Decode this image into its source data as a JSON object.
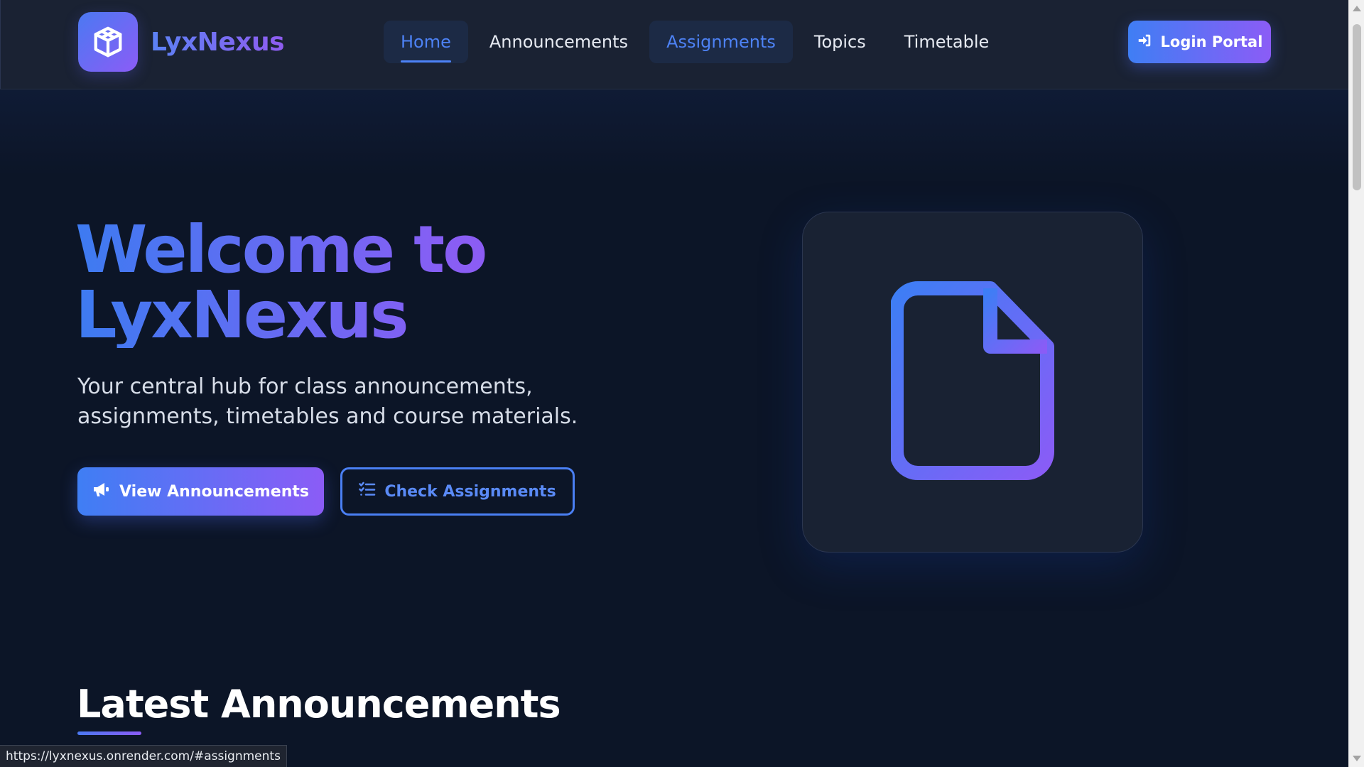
{
  "brand": {
    "name": "LyxNexus",
    "logo_icon": "cube-icon"
  },
  "nav": {
    "items": [
      {
        "label": "Home",
        "state": "active"
      },
      {
        "label": "Announcements",
        "state": "normal"
      },
      {
        "label": "Assignments",
        "state": "hover"
      },
      {
        "label": "Topics",
        "state": "normal"
      },
      {
        "label": "Timetable",
        "state": "normal"
      }
    ]
  },
  "header": {
    "login_label": "Login Portal",
    "login_icon": "sign-in-icon"
  },
  "hero": {
    "title_line1": "Welcome to",
    "title_line2": "LyxNexus",
    "subtitle": "Your central hub for class announcements, assignments, timetables and course materials.",
    "primary_button": {
      "label": "View Announcements",
      "icon": "megaphone-icon"
    },
    "secondary_button": {
      "label": "Check Assignments",
      "icon": "list-check-icon"
    },
    "card_icon": "file-icon"
  },
  "section": {
    "title": "Latest Announcements"
  },
  "status_bar": {
    "url": "https://lyxnexus.onrender.com/#assignments"
  },
  "colors": {
    "accent_blue": "#3f7ef4",
    "accent_purple": "#8b5cf6",
    "background": "#0c1527",
    "header_bg": "#1a2233"
  }
}
